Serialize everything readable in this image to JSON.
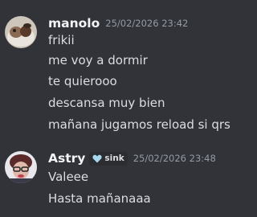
{
  "messages": [
    {
      "username": "manolo",
      "timestamp": "25/02/2026 23:42",
      "lines": [
        "frikii",
        "me voy a dormir",
        "te quierooo",
        "descansa muy bien",
        "mañana jugamos reload si qrs"
      ]
    },
    {
      "username": "Astry",
      "badge": "sink",
      "badge_icon": "heart-icon",
      "timestamp": "25/02/2026 23:48",
      "lines": [
        "Valeee",
        "Hasta mañanaaa"
      ]
    }
  ],
  "colors": {
    "background": "#313338",
    "username": "#f2f3f5",
    "text": "#dbdee1",
    "timestamp": "#949ba4",
    "badge_heart": "#a8d8f0"
  }
}
